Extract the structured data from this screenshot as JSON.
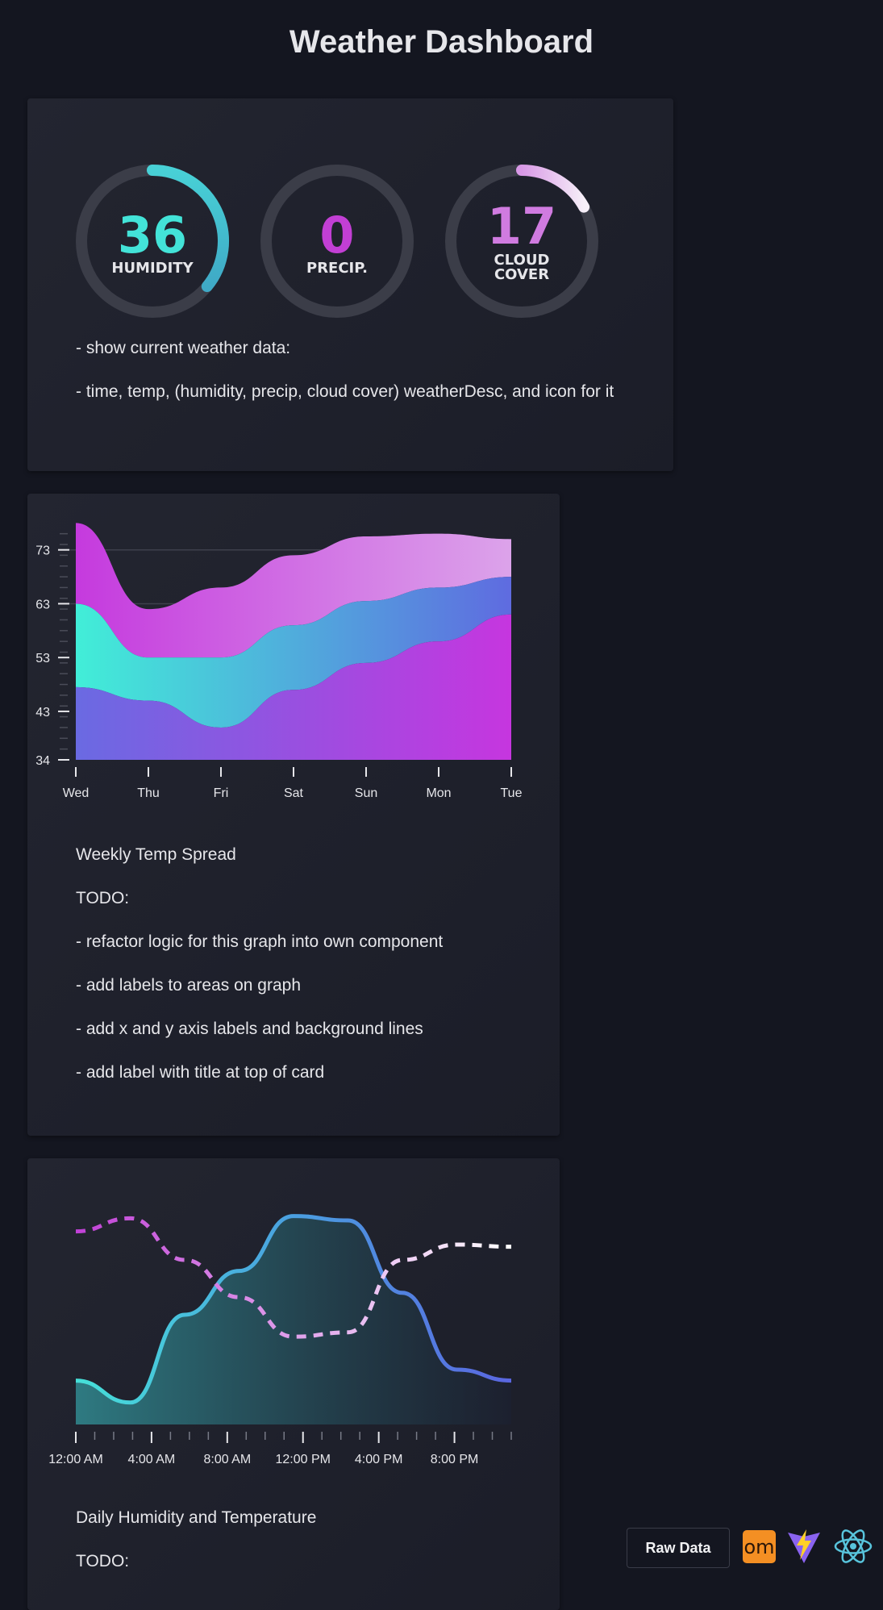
{
  "header": {
    "title": "Weather Dashboard"
  },
  "current": {
    "gauges": [
      {
        "value": "36",
        "label": "HUMIDITY",
        "fraction": 0.36
      },
      {
        "value": "0",
        "label": "PRECIP.",
        "fraction": 0
      },
      {
        "value": "17",
        "label_line1": "CLOUD",
        "label_line2": "COVER",
        "fraction": 0.17
      }
    ],
    "notes": [
      "- show current weather data:",
      "- time, temp, (humidity, precip, cloud cover) weatherDesc, and icon for it"
    ]
  },
  "weekly": {
    "notes": [
      "Weekly Temp Spread",
      "TODO:",
      "- refactor logic for this graph into own component",
      "- add labels to areas on graph",
      "- add x and y axis labels and background lines",
      "- add label with title at top of card"
    ]
  },
  "daily": {
    "notes": [
      "Daily Humidity and Temperature",
      "TODO:"
    ]
  },
  "footer": {
    "raw_data_label": "Raw Data",
    "om_logo_text": "om"
  },
  "chart_data": [
    {
      "type": "area",
      "x": [
        "Wed",
        "Thu",
        "Fri",
        "Sat",
        "Sun",
        "Mon",
        "Tue"
      ],
      "ylim": [
        34,
        77
      ],
      "y_ticks": [
        "73",
        "63",
        "53",
        "43",
        "34"
      ],
      "series": [
        {
          "values": [
            78,
            62,
            66,
            72,
            75.5,
            76,
            75
          ]
        },
        {
          "values": [
            63,
            53,
            53,
            59,
            63.5,
            66,
            68
          ]
        },
        {
          "values": [
            47.5,
            45,
            40,
            47,
            52,
            56,
            61
          ]
        }
      ]
    },
    {
      "type": "line",
      "x": [
        "12:00 AM",
        "4:00 AM",
        "8:00 AM",
        "12:00 PM",
        "4:00 PM",
        "8:00 PM"
      ],
      "ylim": [
        0,
        100
      ],
      "series": [
        {
          "style": "solid",
          "values": [
            20,
            10,
            50,
            70,
            95,
            93,
            60,
            25,
            20
          ]
        },
        {
          "style": "dashed",
          "values": [
            88,
            94,
            75,
            58,
            40,
            42,
            75,
            82,
            81
          ]
        }
      ]
    }
  ]
}
